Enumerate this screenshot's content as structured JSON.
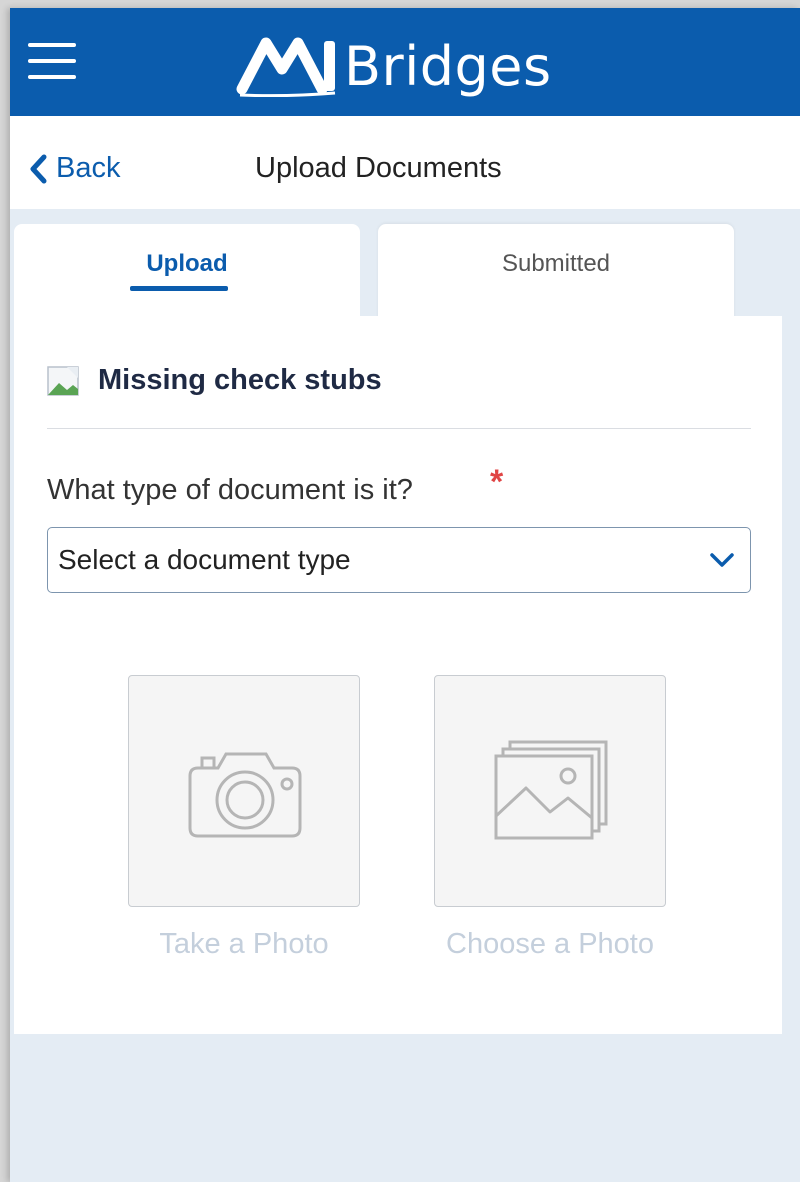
{
  "header": {
    "logo_text": "Bridges",
    "logo_mark": "MI",
    "menu_icon": "hamburger-menu-icon",
    "brand_color": "#0b5cad"
  },
  "nav": {
    "back_label": "Back",
    "back_icon": "chevron-left-icon",
    "title": "Upload Documents"
  },
  "tabs": [
    {
      "label": "Upload",
      "active": true
    },
    {
      "label": "Submitted",
      "active": false
    }
  ],
  "form": {
    "section_title": "Missing check stubs",
    "section_icon": "broken-image-icon",
    "question": "What type of document is it?",
    "required_marker": "*",
    "select_value": "Select a document type",
    "select_icon": "chevron-down-icon"
  },
  "actions": {
    "take_photo": {
      "label": "Take a Photo",
      "icon": "camera-icon"
    },
    "choose_photo": {
      "label": "Choose a Photo",
      "icon": "photo-gallery-icon"
    }
  }
}
